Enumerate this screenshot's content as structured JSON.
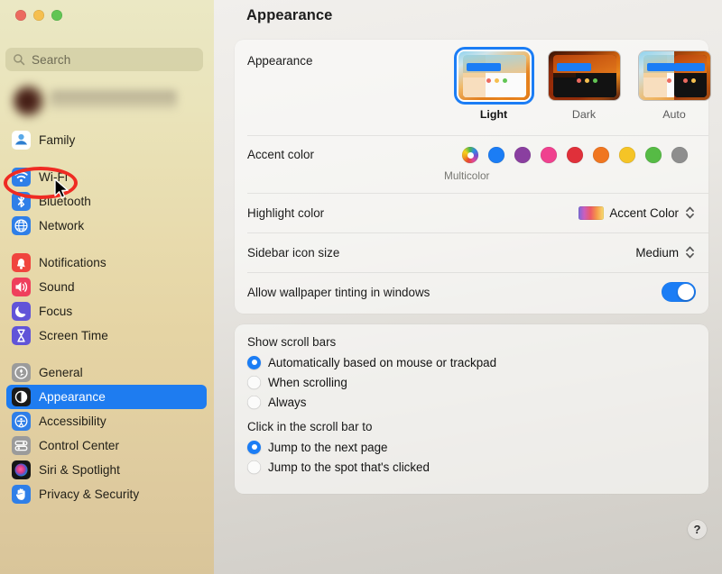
{
  "window": {
    "traffic_lights": [
      {
        "name": "close",
        "color": "#ec6a5f"
      },
      {
        "name": "minimize",
        "color": "#f5bf4f"
      },
      {
        "name": "zoom",
        "color": "#61c554"
      }
    ]
  },
  "sidebar": {
    "search": {
      "placeholder": "Search",
      "value": ""
    },
    "account": {
      "blurred": true
    },
    "groups": [
      {
        "items": [
          {
            "label": "Family",
            "icon": "family-icon",
            "selected": false
          }
        ]
      },
      {
        "items": [
          {
            "label": "Wi-Fi",
            "icon": "wifi-icon",
            "selected": false,
            "annotated": true
          },
          {
            "label": "Bluetooth",
            "icon": "bluetooth-icon",
            "selected": false
          },
          {
            "label": "Network",
            "icon": "network-icon",
            "selected": false
          }
        ]
      },
      {
        "items": [
          {
            "label": "Notifications",
            "icon": "notifications-icon",
            "selected": false
          },
          {
            "label": "Sound",
            "icon": "sound-icon",
            "selected": false
          },
          {
            "label": "Focus",
            "icon": "focus-icon",
            "selected": false
          },
          {
            "label": "Screen Time",
            "icon": "screen-time-icon",
            "selected": false
          }
        ]
      },
      {
        "items": [
          {
            "label": "General",
            "icon": "general-icon",
            "selected": false
          },
          {
            "label": "Appearance",
            "icon": "appearance-icon",
            "selected": true
          },
          {
            "label": "Accessibility",
            "icon": "accessibility-icon",
            "selected": false
          },
          {
            "label": "Control Center",
            "icon": "control-center-icon",
            "selected": false
          },
          {
            "label": "Siri & Spotlight",
            "icon": "siri-icon",
            "selected": false
          },
          {
            "label": "Privacy & Security",
            "icon": "privacy-icon",
            "selected": false
          }
        ]
      }
    ]
  },
  "main": {
    "title": "Appearance",
    "appearance_row": {
      "label": "Appearance",
      "options": [
        {
          "label": "Light",
          "selected": true
        },
        {
          "label": "Dark",
          "selected": false
        },
        {
          "label": "Auto",
          "selected": false
        }
      ]
    },
    "accent_row": {
      "label": "Accent color",
      "caption": "Multicolor",
      "selected_index": 0,
      "swatches": [
        {
          "name": "multicolor",
          "color": "multicolor"
        },
        {
          "name": "blue",
          "color": "#1b7df5"
        },
        {
          "name": "purple",
          "color": "#8a3fa0"
        },
        {
          "name": "pink",
          "color": "#f0418f"
        },
        {
          "name": "red",
          "color": "#e0303a"
        },
        {
          "name": "orange",
          "color": "#f07620"
        },
        {
          "name": "yellow",
          "color": "#f5c426"
        },
        {
          "name": "green",
          "color": "#56bb45"
        },
        {
          "name": "graphite",
          "color": "#8e8e8e"
        }
      ]
    },
    "highlight_row": {
      "label": "Highlight color",
      "value": "Accent Color"
    },
    "sidebar_size_row": {
      "label": "Sidebar icon size",
      "value": "Medium"
    },
    "tint_row": {
      "label": "Allow wallpaper tinting in windows",
      "toggle_on": true
    },
    "scroll_bars_group": {
      "title": "Show scroll bars",
      "options": [
        {
          "label": "Automatically based on mouse or trackpad",
          "selected": true
        },
        {
          "label": "When scrolling",
          "selected": false
        },
        {
          "label": "Always",
          "selected": false
        }
      ]
    },
    "scroll_click_group": {
      "title": "Click in the scroll bar to",
      "options": [
        {
          "label": "Jump to the next page",
          "selected": true
        },
        {
          "label": "Jump to the spot that's clicked",
          "selected": false
        }
      ]
    },
    "help_label": "?"
  },
  "annotation": {
    "target": "Wi-Fi",
    "color": "#ef2b23",
    "shape": "oval"
  }
}
